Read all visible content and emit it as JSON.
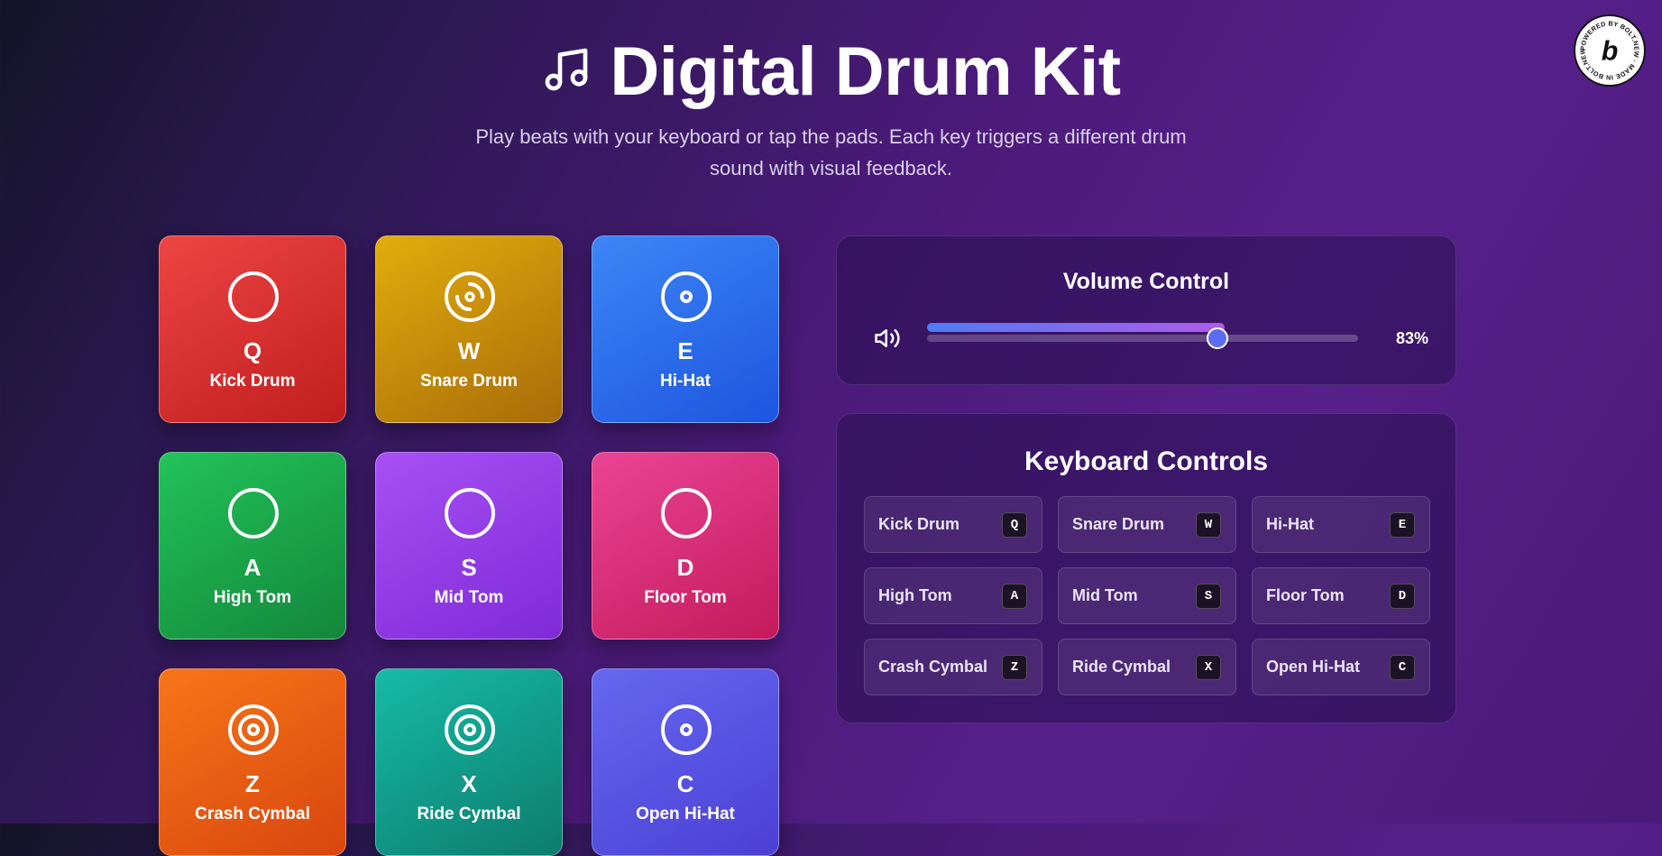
{
  "header": {
    "icon": "music-note-icon",
    "title": "Digital Drum Kit",
    "subtitle": "Play beats with your keyboard or tap the pads. Each key triggers a different drum sound with visual feedback."
  },
  "badge": {
    "text": "POWERED BY BOLT.NEW · MADE IN BOLT.NEW ·",
    "letter": "b"
  },
  "pads": [
    {
      "key": "Q",
      "name": "Kick Drum",
      "icon": "ring-icon",
      "colors": [
        "#ee4444",
        "#c01e1e"
      ]
    },
    {
      "key": "W",
      "name": "Snare Drum",
      "icon": "disc-icon",
      "colors": [
        "#e2ad0c",
        "#a86c09"
      ]
    },
    {
      "key": "E",
      "name": "Hi-Hat",
      "icon": "record-icon",
      "colors": [
        "#3d86f6",
        "#1d55df"
      ]
    },
    {
      "key": "A",
      "name": "High Tom",
      "icon": "ring-icon",
      "colors": [
        "#22c35a",
        "#13873a"
      ]
    },
    {
      "key": "S",
      "name": "Mid Tom",
      "icon": "ring-icon",
      "colors": [
        "#a750f4",
        "#7f2ad8"
      ]
    },
    {
      "key": "D",
      "name": "Floor Tom",
      "icon": "ring-icon",
      "colors": [
        "#ea4494",
        "#c41a5c"
      ]
    },
    {
      "key": "Z",
      "name": "Crash Cymbal",
      "icon": "target-icon",
      "colors": [
        "#f77619",
        "#d8460e"
      ]
    },
    {
      "key": "X",
      "name": "Ride Cymbal",
      "icon": "target-icon",
      "colors": [
        "#16bba6",
        "#0d7c6e"
      ]
    },
    {
      "key": "C",
      "name": "Open Hi-Hat",
      "icon": "record-icon",
      "colors": [
        "#6468f0",
        "#4c3fd4"
      ]
    }
  ],
  "volume": {
    "title": "Volume Control",
    "icon": "speaker-icon",
    "value": 0.83,
    "display": "83%",
    "accent": "#5d6cf0"
  },
  "keyboard": {
    "title": "Keyboard Controls",
    "items": [
      {
        "label": "Kick Drum",
        "key": "Q"
      },
      {
        "label": "Snare Drum",
        "key": "W"
      },
      {
        "label": "Hi-Hat",
        "key": "E"
      },
      {
        "label": "High Tom",
        "key": "A"
      },
      {
        "label": "Mid Tom",
        "key": "S"
      },
      {
        "label": "Floor Tom",
        "key": "D"
      },
      {
        "label": "Crash Cymbal",
        "key": "Z"
      },
      {
        "label": "Ride Cymbal",
        "key": "X"
      },
      {
        "label": "Open Hi-Hat",
        "key": "C"
      }
    ]
  }
}
